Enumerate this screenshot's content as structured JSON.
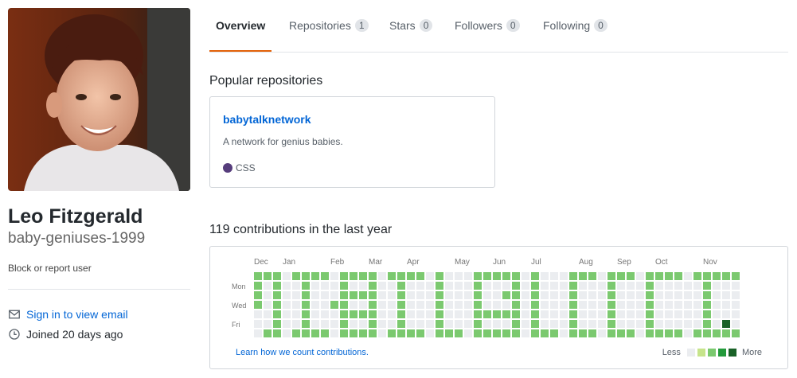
{
  "profile": {
    "full_name": "Leo Fitzgerald",
    "username": "baby-geniuses-1999",
    "block_label": "Block or report user",
    "email_label": "Sign in to view email",
    "joined_label": "Joined 20 days ago",
    "email_icon": "mail-icon",
    "joined_icon": "clock-icon"
  },
  "tabs": [
    {
      "label": "Overview",
      "count": null,
      "selected": true
    },
    {
      "label": "Repositories",
      "count": "1",
      "selected": false
    },
    {
      "label": "Stars",
      "count": "0",
      "selected": false
    },
    {
      "label": "Followers",
      "count": "0",
      "selected": false
    },
    {
      "label": "Following",
      "count": "0",
      "selected": false
    }
  ],
  "popular": {
    "title": "Popular repositories",
    "repos": [
      {
        "name": "babytalknetwork",
        "description": "A network for genius babies.",
        "language": "CSS",
        "language_color": "#563d7c"
      }
    ]
  },
  "contributions": {
    "title": "119 contributions in the last year",
    "months": [
      "Dec",
      "Jan",
      "Feb",
      "Mar",
      "Apr",
      "May",
      "Jun",
      "Jul",
      "Aug",
      "Sep",
      "Oct",
      "Nov"
    ],
    "month_week_index": [
      0,
      3,
      8,
      12,
      16,
      21,
      25,
      29,
      34,
      38,
      42,
      47
    ],
    "weekdays": [
      "Mon",
      "Wed",
      "Fri"
    ],
    "learn_label": "Learn how we count contributions.",
    "legend_less": "Less",
    "legend_more": "More",
    "colors": [
      "#ebedf0",
      "#c6e48b",
      "#7bc96f",
      "#239a3b",
      "#196127"
    ],
    "grid": [
      "2222000",
      "2000002",
      "2222222",
      "0000000",
      "2000002",
      "2222222",
      "2000002",
      "2000002",
      "0002000",
      "2222222",
      "2020202",
      "2020202",
      "2222222",
      "0000000",
      "2000002",
      "2222222",
      "2000002",
      "2000002",
      "0000000",
      "2222222",
      "0000002",
      "0000002",
      "0000000",
      "2222222",
      "2000202",
      "2000202",
      "2020202",
      "2222222",
      "0000000",
      "2222222",
      "0000002",
      "0000002",
      "0000000",
      "2222222",
      "2000002",
      "2000002",
      "0000000",
      "2222222",
      "2000002",
      "2000002",
      "0000000",
      "2222222",
      "2000002",
      "2000002",
      "2000002",
      "0000000",
      "2000002",
      "2222222",
      "2000002",
      "2000042",
      "2000002"
    ]
  }
}
